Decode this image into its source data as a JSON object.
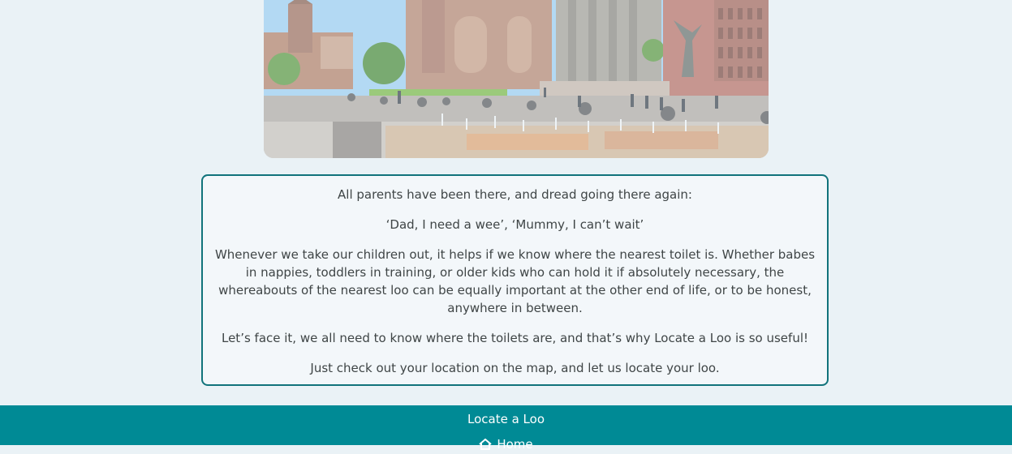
{
  "hero": {
    "image_name": "city-cathedral-ruins-photo"
  },
  "intro": {
    "paragraphs": [
      "All parents have been there, and dread going there again:",
      "‘Dad, I need a wee’, ‘Mummy, I can’t wait’",
      "Whenever we take our children out, it helps if we know where the nearest toilet is. Whether babes in nappies, toddlers in training, or older kids who can hold it if absolutely necessary, the whereabouts of the nearest loo can be equally important at the other end of life, or to be honest, anywhere in between.",
      "Let’s face it, we all need to know where the toilets are, and that’s why Locate a Loo is so useful!",
      "Just check out your location on the map, and let us locate your loo."
    ]
  },
  "footer": {
    "brand": "Locate a Loo",
    "nav": {
      "home_label": "Home",
      "home_icon": "home-icon"
    }
  },
  "colors": {
    "background": "#eaf2f6",
    "accent": "#008a95",
    "border": "#11737b",
    "text": "#3f4546"
  }
}
